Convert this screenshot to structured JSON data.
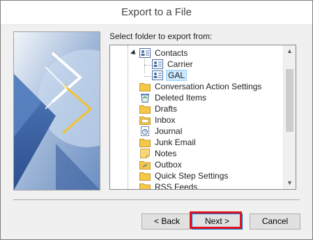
{
  "dialog": {
    "title": "Export to a File",
    "prompt": "Select folder to export from:"
  },
  "tree": {
    "items": [
      {
        "label": "Contacts",
        "icon": "contacts-icon",
        "level": 1,
        "expanded": true
      },
      {
        "label": "Carrier",
        "icon": "contact-card-icon",
        "level": 2
      },
      {
        "label": "GAL",
        "icon": "contact-card-icon",
        "level": 2,
        "selected": true
      },
      {
        "label": "Conversation Action Settings",
        "icon": "folder-icon",
        "level": 1
      },
      {
        "label": "Deleted Items",
        "icon": "recycle-bin-icon",
        "level": 1
      },
      {
        "label": "Drafts",
        "icon": "folder-icon",
        "level": 1
      },
      {
        "label": "Inbox",
        "icon": "inbox-icon",
        "level": 1
      },
      {
        "label": "Journal",
        "icon": "journal-icon",
        "level": 1
      },
      {
        "label": "Junk Email",
        "icon": "folder-icon",
        "level": 1
      },
      {
        "label": "Notes",
        "icon": "notes-icon",
        "level": 1
      },
      {
        "label": "Outbox",
        "icon": "outbox-icon",
        "level": 1
      },
      {
        "label": "Quick Step Settings",
        "icon": "folder-icon",
        "level": 1
      },
      {
        "label": "RSS Feeds",
        "icon": "folder-icon",
        "level": 1
      }
    ]
  },
  "buttons": {
    "back": "< Back",
    "next": "Next >",
    "cancel": "Cancel"
  },
  "colors": {
    "highlight": "#e0141e",
    "selection": "#cce8ff",
    "folder": "#f5c84a"
  }
}
